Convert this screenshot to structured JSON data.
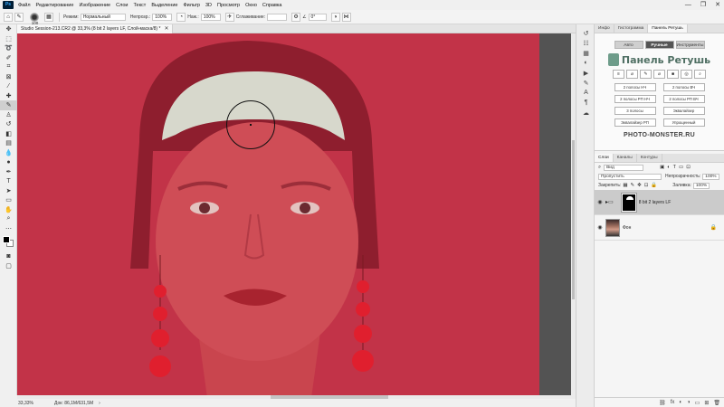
{
  "menu": {
    "app_logo": "Ps",
    "items": [
      "Файл",
      "Редактирование",
      "Изображение",
      "Слои",
      "Текст",
      "Выделение",
      "Фильтр",
      "3D",
      "Просмотр",
      "Окно",
      "Справка"
    ],
    "window_controls": [
      "—",
      "❐",
      "✕"
    ]
  },
  "options": {
    "brush_size": "100",
    "mode_label": "Режим:",
    "mode_value": "Нормальный",
    "opacity_label": "Непрозр.:",
    "opacity_value": "100%",
    "pressure_label": "Наж.:",
    "pressure_value": "100%",
    "smoothing_label": "Сглаживание:",
    "smoothing_value": "",
    "angle_value": "0°"
  },
  "document": {
    "tab_title": "Studio Session-213.CR2 @ 33,3% (8 bit 2 layers LF, Слой-маска/8) *",
    "tab_close": "✕"
  },
  "status": {
    "zoom": "33,33%",
    "doc_info": "Док: 86,1M/631,5M",
    "arrow": "›"
  },
  "panel_tabs": [
    "Инфо",
    "Гистограмма",
    "Панель Ретушь"
  ],
  "retouch": {
    "modes": [
      "Авто",
      "Ручные",
      "Инструменты"
    ],
    "title": "Панель Ретушь",
    "icons": [
      "≡",
      "⌀",
      "✎",
      "⌀",
      "■",
      "◎",
      "⌕"
    ],
    "buttons": [
      "2 полосы НЧ",
      "2 полосы ВЧ",
      "2 полосы РП НЧ",
      "2 полосы РП ВЧ",
      "3 полосы",
      "Эквалайзер",
      "Эквалайзер РП",
      "Упрощенный"
    ],
    "site": "PHOTO-MONSTER.RU"
  },
  "layers_panel": {
    "tabs": [
      "Слои",
      "Каналы",
      "Контуры"
    ],
    "filter_value": "Вид",
    "blend_mode": "Пропустить",
    "opacity_label": "Непрозрачность:",
    "opacity_value": "100%",
    "lock_label": "Закрепить:",
    "fill_label": "Заливка:",
    "fill_value": "100%",
    "layers": [
      {
        "name": "8 bit 2 layers LF"
      },
      {
        "name": "Фон"
      }
    ],
    "footer_icons": [
      "⛓",
      "fx",
      "◐",
      "◑",
      "▭",
      "⊞",
      "🗑"
    ]
  }
}
